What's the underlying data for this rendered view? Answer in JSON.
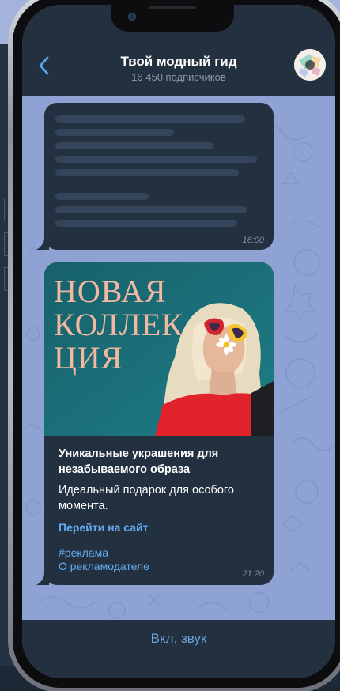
{
  "channel": {
    "title": "Твой модный гид",
    "subscribers": "16 450 подписчиков"
  },
  "messages": [
    {
      "type": "placeholder",
      "time": "16:00"
    },
    {
      "type": "ad",
      "image_text": [
        "НОВАЯ",
        "КОЛЛЕК",
        "ЦИЯ"
      ],
      "title": "Уникальные украшения для незабываемого образа",
      "description": "Идеальный подарок для особого момента.",
      "link_label": "Перейти на сайт",
      "hashtag": "#реклама",
      "advertiser_link": "О рекламодателе",
      "time": "21:20"
    }
  ],
  "bottom_bar": {
    "action_label": "Вкл. звук"
  },
  "colors": {
    "header_bg": "#23303f",
    "chat_bg": "#8ea2d4",
    "bubble_bg": "#23303f",
    "link": "#64aaf0",
    "ad_image_bg": "#1d6f78",
    "ad_headline": "#f2b8a0"
  }
}
